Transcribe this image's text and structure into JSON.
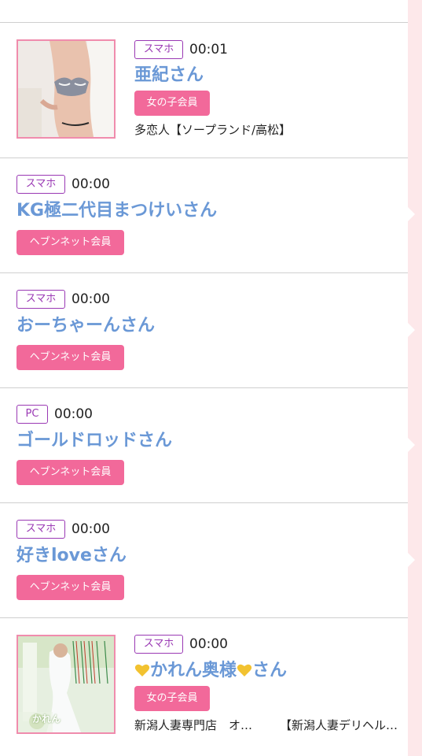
{
  "colors": {
    "accent": "#f2699a",
    "name": "#6a98d6",
    "device_border": "#9a39b4",
    "background": "#fde8ea"
  },
  "entries": [
    {
      "device": "スマホ",
      "time": "00:01",
      "name": "亜紀さん",
      "badge": "女の子会員",
      "shop": "多恋人【ソープランド/高松】",
      "has_photo": true
    },
    {
      "device": "スマホ",
      "time": "00:00",
      "name": "KG極二代目まつけいさん",
      "badge": "ヘブンネット会員"
    },
    {
      "device": "スマホ",
      "time": "00:00",
      "name": "おーちゃーんさん",
      "badge": "ヘブンネット会員"
    },
    {
      "device": "PC",
      "time": "00:00",
      "name": "ゴールドロッドさん",
      "badge": "ヘブンネット会員"
    },
    {
      "device": "スマホ",
      "time": "00:00",
      "name": "好きloveさん",
      "badge": "ヘブンネット会員"
    },
    {
      "device": "スマホ",
      "time": "00:00",
      "name_icon": "yellow-heart-icon",
      "name_mid": "かれん奥様",
      "name_tail": "さん",
      "badge": "女の子会員",
      "shop_a": "新潟人妻専門店　オ…",
      "shop_b": "【新潟人妻デリヘル…",
      "has_photo": true,
      "photo_caption": "かれん"
    }
  ]
}
